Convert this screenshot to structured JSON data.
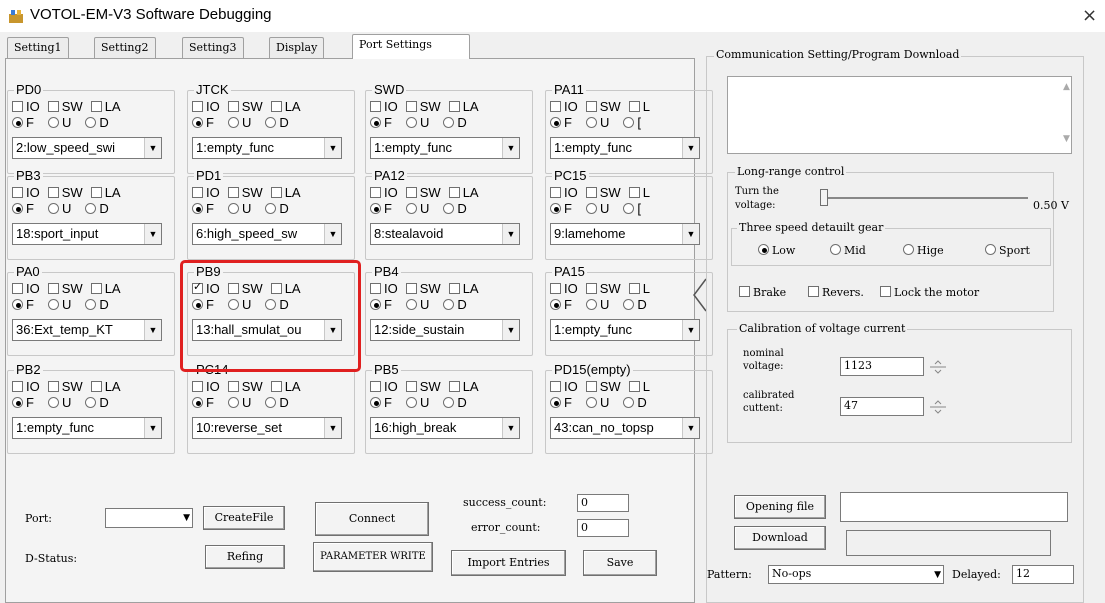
{
  "window": {
    "title": "VOTOL-EM-V3 Software Debugging",
    "close": "×"
  },
  "tabs": [
    {
      "label": "Setting1"
    },
    {
      "label": "Setting2"
    },
    {
      "label": "Setting3"
    },
    {
      "label": "Display"
    },
    {
      "label": "Port Settings",
      "active": true
    }
  ],
  "ports": [
    {
      "name": "PD0",
      "io": false,
      "c2": "SW",
      "c3": "LA",
      "r3": "D",
      "selected": "F",
      "value": "2:low_speed_swi"
    },
    {
      "name": "JTCK",
      "io": false,
      "c2": "SW",
      "c3": "LA",
      "r3": "D",
      "selected": "F",
      "value": "1:empty_func"
    },
    {
      "name": "SWD",
      "io": false,
      "c2": "SW",
      "c3": "LA",
      "r3": "D",
      "selected": "F",
      "value": "1:empty_func"
    },
    {
      "name": "PA11",
      "io": false,
      "c2": "SW",
      "c3": "L",
      "r3": "[",
      "selected": "F",
      "value": "1:empty_func"
    },
    {
      "name": "PB3",
      "io": false,
      "c2": "SW",
      "c3": "LA",
      "r3": "D",
      "selected": "F",
      "value": "18:sport_input"
    },
    {
      "name": "PD1",
      "io": false,
      "c2": "SW",
      "c3": "LA",
      "r3": "D",
      "selected": "F",
      "value": "6:high_speed_sw"
    },
    {
      "name": "PA12",
      "io": false,
      "c2": "SW",
      "c3": "LA",
      "r3": "D",
      "selected": "F",
      "value": "8:stealavoid"
    },
    {
      "name": "PC15",
      "io": false,
      "c2": "SW",
      "c3": "L",
      "r3": "[",
      "selected": "F",
      "value": "9:lamehome"
    },
    {
      "name": "PA0",
      "io": false,
      "c2": "SW",
      "c3": "LA",
      "r3": "D",
      "selected": "F",
      "value": "36:Ext_temp_KT"
    },
    {
      "name": "PB9",
      "io": true,
      "c2": "SW",
      "c3": "LA",
      "r3": "D",
      "selected": "F",
      "value": "13:hall_smulat_ou"
    },
    {
      "name": "PB4",
      "io": false,
      "c2": "SW",
      "c3": "LA",
      "r3": "D",
      "selected": "F",
      "value": "12:side_sustain"
    },
    {
      "name": "PA15",
      "io": false,
      "c2": "SW",
      "c3": "L",
      "r3": "D",
      "selected": "F",
      "value": "1:empty_func"
    },
    {
      "name": "PB2",
      "io": false,
      "c2": "SW",
      "c3": "LA",
      "r3": "D",
      "selected": "F",
      "value": "1:empty_func"
    },
    {
      "name": "PC14",
      "io": false,
      "c2": "SW",
      "c3": "LA",
      "r3": "D",
      "selected": "F",
      "value": "10:reverse_set"
    },
    {
      "name": "PB5",
      "io": false,
      "c2": "SW",
      "c3": "LA",
      "r3": "D",
      "selected": "F",
      "value": "16:high_break"
    },
    {
      "name": "PD15(empty)",
      "io": false,
      "c2": "SW",
      "c3": "L",
      "r3": "D",
      "selected": "F",
      "value": "43:can_no_topsp"
    }
  ],
  "checkbox_labels": {
    "io": "IO"
  },
  "radio_labels": {
    "f": "F",
    "u": "U"
  },
  "bottom": {
    "port_label": "Port:",
    "port_value": "",
    "createfile": "CreateFile",
    "connect": "Connect",
    "success_label": "success_count:",
    "success_value": "0",
    "error_label": "error_count:",
    "error_value": "0",
    "dstatus_label": "D-Status:",
    "refing": "Refing",
    "param_write": "PARAMETER WRITE",
    "import": "Import Entries",
    "save": "Save"
  },
  "right": {
    "comm_title": "Communication Setting/Program Download",
    "long_range_title": "Long-range control",
    "turn_voltage_label_1": "Turn the",
    "turn_voltage_label_2": "voltage:",
    "voltage_value": "0.50 V",
    "voltage_level": 0.0,
    "gear_title": "Three speed detauilt gear",
    "gears": [
      "Low",
      "Mid",
      "Hige",
      "Sport"
    ],
    "gear_selected": "Low",
    "brake": "Brake",
    "reverse": "Revers.",
    "lock": "Lock the motor",
    "calib_title": "Calibration of voltage current",
    "nominal_1": "nominal",
    "nominal_2": "voltage:",
    "nominal_value": "1123",
    "calibrated_1": "calibrated",
    "calibrated_2": "cuttent:",
    "calibrated_value": "47",
    "opening_file": "Opening file",
    "opening_file_value": "",
    "download": "Download",
    "download_value": "",
    "pattern_label": "Pattern:",
    "pattern_value": "No-ops",
    "delayed_label": "Delayed:",
    "delayed_value": "12"
  }
}
